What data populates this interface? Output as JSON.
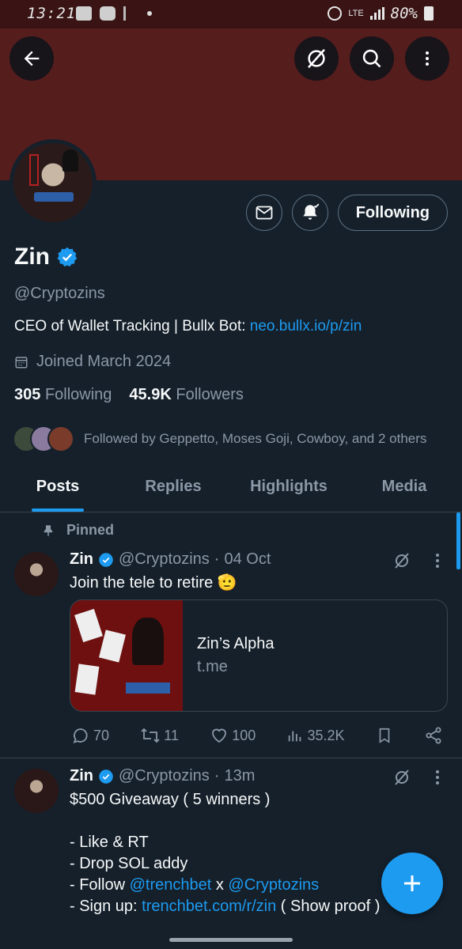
{
  "status_bar": {
    "time": "13:21",
    "network": "LTE",
    "battery": "80%"
  },
  "profile": {
    "name": "Zin",
    "handle": "@Cryptozins",
    "bio_text": "CEO of Wallet Tracking | Bullx Bot: ",
    "bio_link": "neo.bullx.io/p/zin",
    "joined": "Joined March 2024",
    "following_count": "305",
    "following_label": "Following",
    "followers_count": "45.9K",
    "followers_label": "Followers",
    "followed_by": "Followed by Geppetto, Moses Goji, Cowboy, and 2 others",
    "follow_button": "Following"
  },
  "tabs": [
    {
      "label": "Posts",
      "active": true
    },
    {
      "label": "Replies",
      "active": false
    },
    {
      "label": "Highlights",
      "active": false
    },
    {
      "label": "Media",
      "active": false
    }
  ],
  "pinned_label": "Pinned",
  "tweets": [
    {
      "name": "Zin",
      "handle": "@Cryptozins",
      "sep": "·",
      "time": "04 Oct",
      "text": "Join the tele to retire 🫡",
      "card_title": "Zin’s Alpha",
      "card_domain": "t.me",
      "replies": "70",
      "retweets": "11",
      "likes": "100",
      "views": "35.2K"
    },
    {
      "name": "Zin",
      "handle": "@Cryptozins",
      "sep": "·",
      "time": "13m",
      "line1": "$500 Giveaway ( 5 winners )",
      "line2": "- Like & RT",
      "line3": "- Drop SOL addy",
      "line4_pre": "- Follow ",
      "line4_m1": "@trenchbet",
      "line4_mid": " x ",
      "line4_m2": "@Cryptozins",
      "line5_pre": "- Sign up: ",
      "line5_link": "trenchbet.com/r/zin",
      "line5_post": " ( Show proof )"
    }
  ],
  "colors": {
    "accent": "#1d9bf0",
    "banner": "#561d1d",
    "background": "#15202b"
  }
}
